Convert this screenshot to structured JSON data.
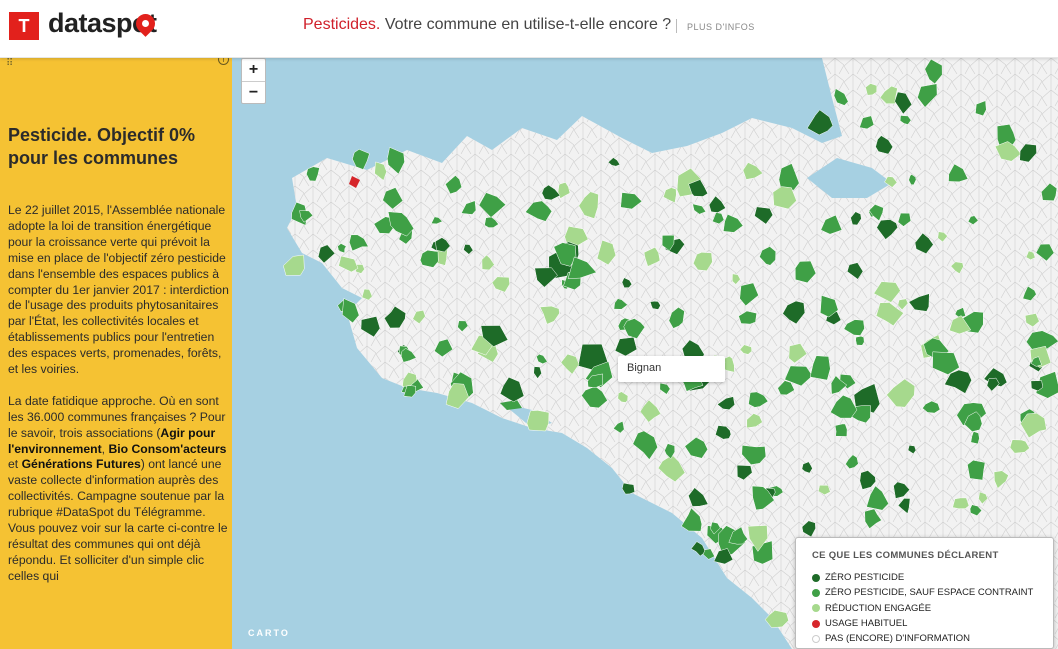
{
  "header": {
    "logo_mark": "T",
    "logo_text": "dataspot",
    "headline_accent": "Pesticides.",
    "headline_rest": "Votre commune en utilise-t-elle encore ?",
    "more_link": "PLUS D'INFOS"
  },
  "sidebar": {
    "grip": "⠿",
    "info": "i",
    "title": "Pesticide. Objectif 0% pour les communes",
    "para1": "Le 22 juillet 2015, l'Assemblée nationale adopte la loi de transition énergétique pour la croissance verte qui prévoit la mise en place de l'objectif zéro pesticide dans l'ensemble des espaces publics à compter du 1er janvier 2017 : interdiction de l'usage des produits phytosanitaires par l'État, les collectivités locales et établissements publics pour l'entretien des espaces verts, promenades, forêts, et les voiries.",
    "para2_a": "La date fatidique approche. Où en sont les 36.000 communes françaises ? Pour le savoir, trois associations (",
    "para2_b1": "Agir pour l'environnement",
    "para2_c": ", ",
    "para2_b2": "Bio Consom'acteurs",
    "para2_d": " et ",
    "para2_b3": "Générations Futures",
    "para2_e": ") ont lancé une vaste collecte d'information auprès des collectivités. Campagne soutenue par la rubrique #DataSpot du Télégramme. Vous pouvez voir sur la carte ci-contre le résultat des communes qui ont déjà répondu. Et solliciter d'un simple clic celles qui"
  },
  "map": {
    "zoom_in": "+",
    "zoom_out": "−",
    "tooltip": "Bignan",
    "attribution": "CARTO",
    "colors": {
      "sea": "#a6d0e2",
      "land": "#f2f2f2",
      "border": "#c8c8c8"
    }
  },
  "legend": {
    "title": "CE QUE LES COMMUNES DÉCLARENT",
    "items": [
      {
        "label": "ZÉRO PESTICIDE",
        "color": "#1e6b28"
      },
      {
        "label": "ZÉRO PESTICIDE, SAUF ESPACE CONTRAINT",
        "color": "#3fa046"
      },
      {
        "label": "RÉDUCTION ENGAGÉE",
        "color": "#a6d98d"
      },
      {
        "label": "USAGE HABITUEL",
        "color": "#d6262b"
      },
      {
        "label": "PAS (ENCORE) D'INFORMATION",
        "color": "#ffffff"
      }
    ]
  }
}
